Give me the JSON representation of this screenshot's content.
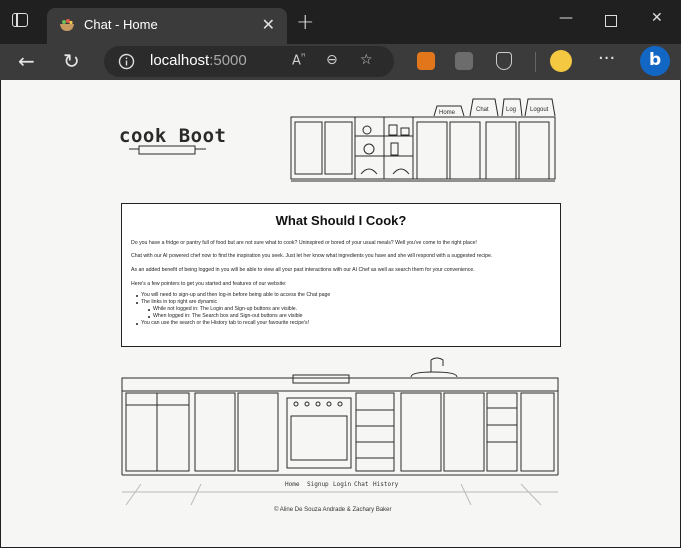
{
  "browser": {
    "tab_title": "Chat - Home",
    "url_host": "localhost",
    "url_port": ":5000"
  },
  "site": {
    "logo": "cook Boot",
    "nav": [
      "Home",
      "Chat",
      "Log",
      "Logout"
    ]
  },
  "card": {
    "heading": "What Should I Cook?",
    "para1": "Do you have a fridge or pantry full of food but are not sure what to cook? Uninspired or bored of your usual meals? Well you've come to the right place!",
    "para2": "Chat with our AI powered chef now to find the inspiration you seek. Just let her know what ingredients you have and she will respond with a suggested recipe.",
    "para3": "As an added benefit of being logged in you will be able to view all your past interactions with our AI Chef as well as search them for your convenience.",
    "para4": "Here's a few pointers to get you started and features of our website:",
    "bullets": [
      "You will need to sign-up and then log-in before being able to access the Chat page",
      "The links in top right are dynamic",
      "While not logged in: The Login and Sign-up buttons are visible.",
      "When logged in: The Search box and Sign-out buttons are visible",
      "You can use the search or the History tab to recall your favourite recipe's!"
    ]
  },
  "footer": {
    "links": [
      "Home",
      "Signup",
      "Login",
      "Chat",
      "History"
    ],
    "copyright": "© Aline De Souza Andrade & Zachary Baker"
  }
}
